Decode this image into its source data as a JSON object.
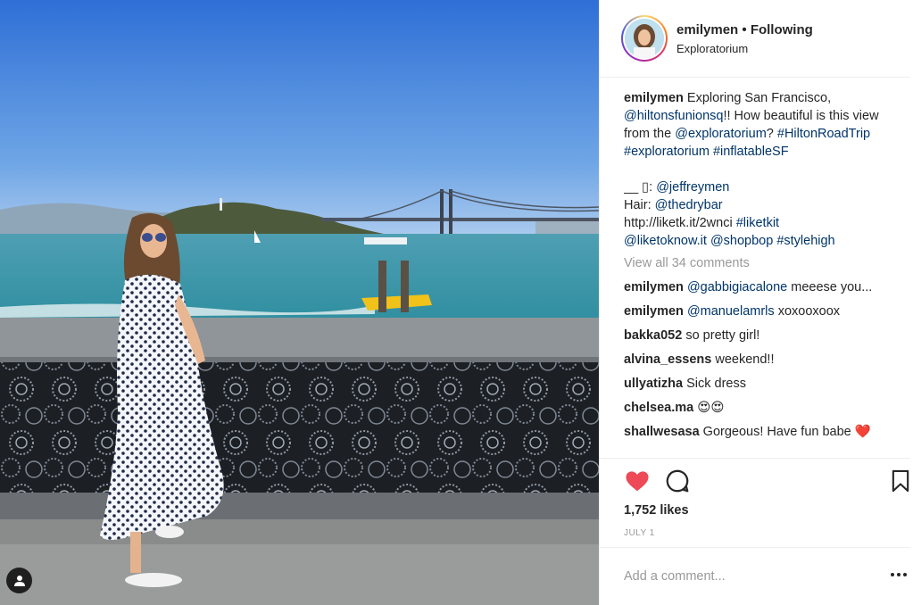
{
  "post": {
    "username": "emilymen",
    "separator": "•",
    "follow_status": "Following",
    "location": "Exploratorium"
  },
  "caption": {
    "username": "emilymen",
    "t1": " Exploring San Francisco, ",
    "m1": "@hiltonsfunionsq",
    "t2": "!! How beautiful is this view from the ",
    "m2": "@exploratorium",
    "t3": "? ",
    "h1": "#HiltonRoadTrip",
    "h2": "#exploratorium",
    "h3": "#inflatableSF",
    "credit_prefix": "__ ▯: ",
    "m3": "@jeffreymen",
    "hair_prefix": "Hair: ",
    "m4": "@thedrybar",
    "url_text": "http://liketk.it/2wnci ",
    "h4": "#liketkit",
    "m5": "@liketoknow.it",
    "m6": "@shopbop",
    "h5": "#stylehigh"
  },
  "view_all": "View all 34 comments",
  "comments": [
    {
      "user": "emilymen",
      "mention": "@gabbigiacalone",
      "text": " meeese you..."
    },
    {
      "user": "emilymen",
      "mention": "@manuelamrls",
      "text": " xoxooxoox"
    },
    {
      "user": "bakka052",
      "mention": "",
      "text": " so pretty girl!"
    },
    {
      "user": "alvina_essens",
      "mention": "",
      "text": " weekend!!"
    },
    {
      "user": "ullyatizha",
      "mention": "",
      "text": " Sick dress"
    },
    {
      "user": "chelsea.ma",
      "mention": "",
      "text": " 😍😍"
    },
    {
      "user": "shallwesasa",
      "mention": "",
      "text": " Gorgeous! Have fun babe ❤️"
    }
  ],
  "likes": "1,752 likes",
  "date": "JULY 1",
  "add_comment_placeholder": "Add a comment...",
  "icons": {
    "like": "heart-icon",
    "comment": "comment-bubble-icon",
    "save": "bookmark-icon",
    "more": "more-options-icon",
    "user_tag": "person-tag-icon"
  },
  "colors": {
    "like_red": "#ed4956",
    "link_blue": "#003569",
    "muted_gray": "#999999"
  }
}
